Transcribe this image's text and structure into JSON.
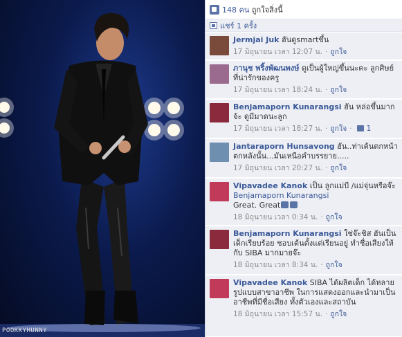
{
  "photo": {
    "watermark": "POOKKYHUNNY"
  },
  "likes": {
    "count": "148 คน",
    "suffix": "ถูกใจสิ่งนี้"
  },
  "shares": {
    "label": "แชร์ 1 ครั้ง"
  },
  "comments": [
    {
      "name": "Jermjai Juk",
      "text": "ฮันดูsmartขึ้น",
      "date": "17 มิถุนายน เวลา 12:07 น.",
      "like_label": "ถูกใจ",
      "avatar_color": "#7a4b3a"
    },
    {
      "name": "ภานุช พริ้งพัฒนพงษ์",
      "text": "ดูเป็นผู้ใหญ่ขึ้นนะคะ ลูกศิษย์ที่น่ารักของครู",
      "date": "17 มิถุนายน เวลา 18:24 น.",
      "like_label": "ถูกใจ",
      "avatar_color": "#9a6b8e"
    },
    {
      "name": "Benjamaporn Kunarangsi",
      "text": "ฮัน หล่อขึ้นมากจ้ะ ดูมีมาดนะลูก",
      "date": "17 มิถุนายน เวลา 18:27 น.",
      "like_label": "ถูกใจ",
      "like_count": "1",
      "avatar_color": "#8b2a3c"
    },
    {
      "name": "Jantaraporn Hunsavong",
      "text": "ฮัน..ท่าเต้นตกหน้าตกหลังนั้น...มันเหนือคำบรรยาย.....",
      "date": "17 มิถุนายน เวลา 20:27 น.",
      "like_label": "ถูกใจ",
      "avatar_color": "#6f8fb0"
    },
    {
      "name": "Vipavadee Kanok",
      "text": "เป็น ลูกแม่บี /แม่จุ่นหรือจ๊ะ",
      "tag": "Benjamaporn Kunarangsi",
      "text2": "Great. Great",
      "date": "18 มิถุนายน เวลา 0:34 น.",
      "like_label": "ถูกใจ",
      "avatar_color": "#c23a5a"
    },
    {
      "name": "Benjamaporn Kunarangsi",
      "text": "ใช่จ๊ะชิส ฮันเป็นเด็กเรียบร้อย ชอบเต้นตั้งแต่เรียนอยู่ ทำชื่อเสียงให้กับ SIBA มากมายจ๊ะ",
      "date": "18 มิถุนายน เวลา 8:34 น.",
      "like_label": "ถูกใจ",
      "avatar_color": "#8b2a3c"
    },
    {
      "name": "Vipavadee Kanok",
      "text": "SIBA ได้ผลิตเด็ก ได้หลายรูปแบบสาขาอาชีพ ในการแสดงออกและนำมาเป็นอาชีพที่มีชื่อเสียง ทั้งตัวเองและสถาบัน",
      "date": "18 มิถุนายน เวลา 15:57 น.",
      "like_label": "ถูกใจ",
      "avatar_color": "#c23a5a"
    }
  ]
}
